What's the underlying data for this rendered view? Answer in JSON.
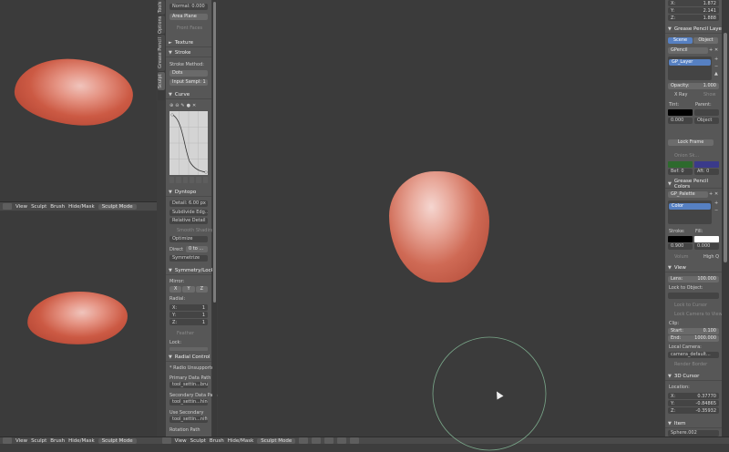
{
  "left_top_viewport": {
    "header": [
      "View",
      "Sculpt",
      "Brush",
      "Hide/Mask",
      "Sculpt Mode"
    ]
  },
  "left_bottom_viewport": {
    "header": [
      "View",
      "Sculpt",
      "Brush",
      "Hide/Mask",
      "Sculpt Mode"
    ]
  },
  "tool_tabs": [
    "Tools",
    "Options",
    "Grease Pencil",
    "Sculpt"
  ],
  "tools_panel": {
    "normal_field": "Normal: 0.000",
    "area_plane": "Area Plane",
    "front_faces": "Front Faces",
    "texture": "Texture",
    "stroke": "Stroke",
    "stroke_method_label": "Stroke Method:",
    "stroke_method": "Dots",
    "input_samples": "Input Sampl: 1",
    "curve": "Curve",
    "dyntopo": "Dyntopo",
    "detail": "Detail: 6.00 px",
    "subdivide": "Subdivide Edg...",
    "relative_detail": "Relative Detail",
    "smooth_shading": "Smooth Shading",
    "optimize": "Optimize",
    "direct": "Direct",
    "direct_val": "0 to ...",
    "symmetrize": "Symmetrize",
    "symmetry_lock": "Symmetry/Lock",
    "mirror_label": "Mirror:",
    "mirror_x": "X",
    "mirror_y": "Y",
    "mirror_z": "Z",
    "radial_label": "Radial:",
    "radial_x": "X:",
    "radial_y": "Y:",
    "radial_z": "Z:",
    "radial_val": "1",
    "feather": "Feather",
    "lock_label": "Lock:",
    "radial_control": "Radial Control",
    "radio_unsupported": "* Radio Unsupported *",
    "primary_data_path": "Primary Data Path",
    "primary_val": "tool_settin...brush.size",
    "secondary_data_path": "Secondary Data Path",
    "secondary_val": "tool_settin...hings.size",
    "use_secondary": "Use Secondary",
    "use_secondary_val": "tool_settin...nified_size",
    "rotation_path": "Rotation Path"
  },
  "bottom_header": {
    "items": [
      "View",
      "Sculpt",
      "Brush",
      "Hide/Mask",
      "Sculpt Mode"
    ],
    "main_items": [
      "View",
      "Sculpt",
      "Brush",
      "Hide/Mask",
      "Sculpt Mode"
    ]
  },
  "right_panel": {
    "x_label": "X:",
    "x_val": "1.872",
    "y_label": "Y:",
    "y_val": "2.141",
    "z_label": "Z:",
    "z_val": "1.888",
    "gp_layers_title": "Grease Pencil Laye",
    "scene_tab": "Scene",
    "object_tab": "Object",
    "gpencil": "GPencil",
    "gp_layer": "GP_Layer",
    "opacity": "Opacity:",
    "opacity_val": "1.000",
    "xray": "X Ray",
    "show": "Show",
    "tint": "Tint:",
    "tint_val": "0.000",
    "parent": "Parent:",
    "parent_val": "Object",
    "lock_frame": "Lock Frame",
    "onion_skin": "Onion Sk...",
    "before_val": "Bef: 0",
    "after_val": "Aft: 0",
    "gp_colors_title": "Grease Pencil Colors",
    "gp_palette": "GP_Palette",
    "color": "Color",
    "stroke": "Stroke:",
    "fill": "Fill:",
    "stroke_val": "0.900",
    "fill_val": "0.000",
    "volum": "Volum",
    "high_q": "High Q",
    "view_title": "View",
    "lens": "Lens:",
    "lens_val": "100.000",
    "lock_to_object": "Lock to Object:",
    "lock_to_cursor": "Lock to Cursor",
    "lock_camera": "Lock Camera to View",
    "clip": "Clip:",
    "start": "Start:",
    "start_val": "0.100",
    "end": "End:",
    "end_val": "1000.000",
    "local_camera": "Local Camera:",
    "local_camera_val": "camera_default...",
    "render_border": "Render Border",
    "cursor_title": "3D Cursor",
    "location": "Location:",
    "cx_label": "X:",
    "cx_val": "0.37770",
    "cy_label": "Y:",
    "cy_val": "-0.84865",
    "cz_label": "Z:",
    "cz_val": "-0.35932",
    "item_title": "Item",
    "item_name": "Sphere.002"
  },
  "colors": {
    "accent_blue": "#5680c2",
    "sculpt_clay": "#cc5a44",
    "brush_circle": "#7aa88a"
  }
}
